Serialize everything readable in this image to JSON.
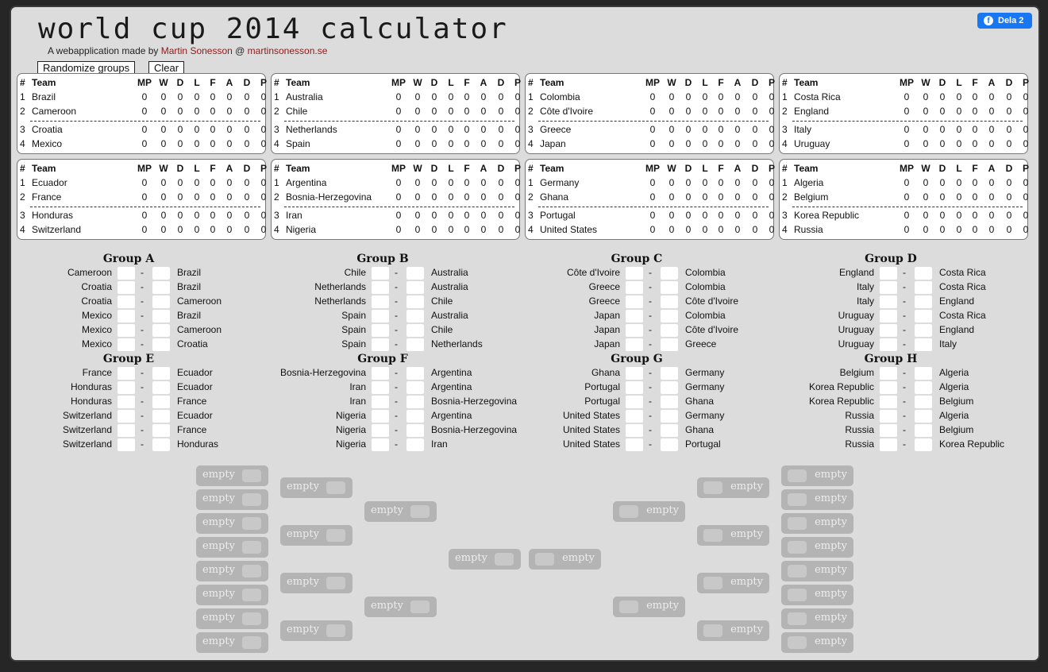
{
  "header": {
    "title": "world cup 2014 calculator",
    "byline_prefix": "A webapplication made by ",
    "author": "Martin Sonesson",
    "at": " @ ",
    "site": "martinsonesson.se",
    "randomize_label": "Randomize groups",
    "clear_label": "Clear",
    "share_label": "Dela 2",
    "share_icon": "facebook-icon"
  },
  "table_header": {
    "num": "#",
    "team": "Team",
    "cols": [
      "MP",
      "W",
      "D",
      "L",
      "F",
      "A",
      "D",
      "P"
    ]
  },
  "standings": [
    {
      "group": "A",
      "teams": [
        "Brazil",
        "Cameroon",
        "Croatia",
        "Mexico"
      ]
    },
    {
      "group": "B",
      "teams": [
        "Australia",
        "Chile",
        "Netherlands",
        "Spain"
      ]
    },
    {
      "group": "C",
      "teams": [
        "Colombia",
        "Côte d'Ivoire",
        "Greece",
        "Japan"
      ]
    },
    {
      "group": "D",
      "teams": [
        "Costa Rica",
        "England",
        "Italy",
        "Uruguay"
      ]
    },
    {
      "group": "E",
      "teams": [
        "Ecuador",
        "France",
        "Honduras",
        "Switzerland"
      ]
    },
    {
      "group": "F",
      "teams": [
        "Argentina",
        "Bosnia-Herzegovina",
        "Iran",
        "Nigeria"
      ]
    },
    {
      "group": "G",
      "teams": [
        "Germany",
        "Ghana",
        "Portugal",
        "United States"
      ]
    },
    {
      "group": "H",
      "teams": [
        "Algeria",
        "Belgium",
        "Korea Republic",
        "Russia"
      ]
    }
  ],
  "stat_value": "0",
  "groups": [
    {
      "title": "Group A",
      "matches": [
        [
          "Cameroon",
          "Brazil"
        ],
        [
          "Croatia",
          "Brazil"
        ],
        [
          "Croatia",
          "Cameroon"
        ],
        [
          "Mexico",
          "Brazil"
        ],
        [
          "Mexico",
          "Cameroon"
        ],
        [
          "Mexico",
          "Croatia"
        ]
      ]
    },
    {
      "title": "Group B",
      "matches": [
        [
          "Chile",
          "Australia"
        ],
        [
          "Netherlands",
          "Australia"
        ],
        [
          "Netherlands",
          "Chile"
        ],
        [
          "Spain",
          "Australia"
        ],
        [
          "Spain",
          "Chile"
        ],
        [
          "Spain",
          "Netherlands"
        ]
      ]
    },
    {
      "title": "Group C",
      "matches": [
        [
          "Côte d'Ivoire",
          "Colombia"
        ],
        [
          "Greece",
          "Colombia"
        ],
        [
          "Greece",
          "Côte d'Ivoire"
        ],
        [
          "Japan",
          "Colombia"
        ],
        [
          "Japan",
          "Côte d'Ivoire"
        ],
        [
          "Japan",
          "Greece"
        ]
      ]
    },
    {
      "title": "Group D",
      "matches": [
        [
          "England",
          "Costa Rica"
        ],
        [
          "Italy",
          "Costa Rica"
        ],
        [
          "Italy",
          "England"
        ],
        [
          "Uruguay",
          "Costa Rica"
        ],
        [
          "Uruguay",
          "England"
        ],
        [
          "Uruguay",
          "Italy"
        ]
      ]
    },
    {
      "title": "Group E",
      "matches": [
        [
          "France",
          "Ecuador"
        ],
        [
          "Honduras",
          "Ecuador"
        ],
        [
          "Honduras",
          "France"
        ],
        [
          "Switzerland",
          "Ecuador"
        ],
        [
          "Switzerland",
          "France"
        ],
        [
          "Switzerland",
          "Honduras"
        ]
      ]
    },
    {
      "title": "Group F",
      "matches": [
        [
          "Bosnia-Herzegovina",
          "Argentina"
        ],
        [
          "Iran",
          "Argentina"
        ],
        [
          "Iran",
          "Bosnia-Herzegovina"
        ],
        [
          "Nigeria",
          "Argentina"
        ],
        [
          "Nigeria",
          "Bosnia-Herzegovina"
        ],
        [
          "Nigeria",
          "Iran"
        ]
      ]
    },
    {
      "title": "Group G",
      "matches": [
        [
          "Ghana",
          "Germany"
        ],
        [
          "Portugal",
          "Germany"
        ],
        [
          "Portugal",
          "Ghana"
        ],
        [
          "United States",
          "Germany"
        ],
        [
          "United States",
          "Ghana"
        ],
        [
          "United States",
          "Portugal"
        ]
      ]
    },
    {
      "title": "Group H",
      "matches": [
        [
          "Belgium",
          "Algeria"
        ],
        [
          "Korea Republic",
          "Algeria"
        ],
        [
          "Korea Republic",
          "Belgium"
        ],
        [
          "Russia",
          "Algeria"
        ],
        [
          "Russia",
          "Belgium"
        ],
        [
          "Russia",
          "Korea Republic"
        ]
      ]
    }
  ],
  "match_separator": "-",
  "knockout": {
    "slot_label": "empty"
  }
}
